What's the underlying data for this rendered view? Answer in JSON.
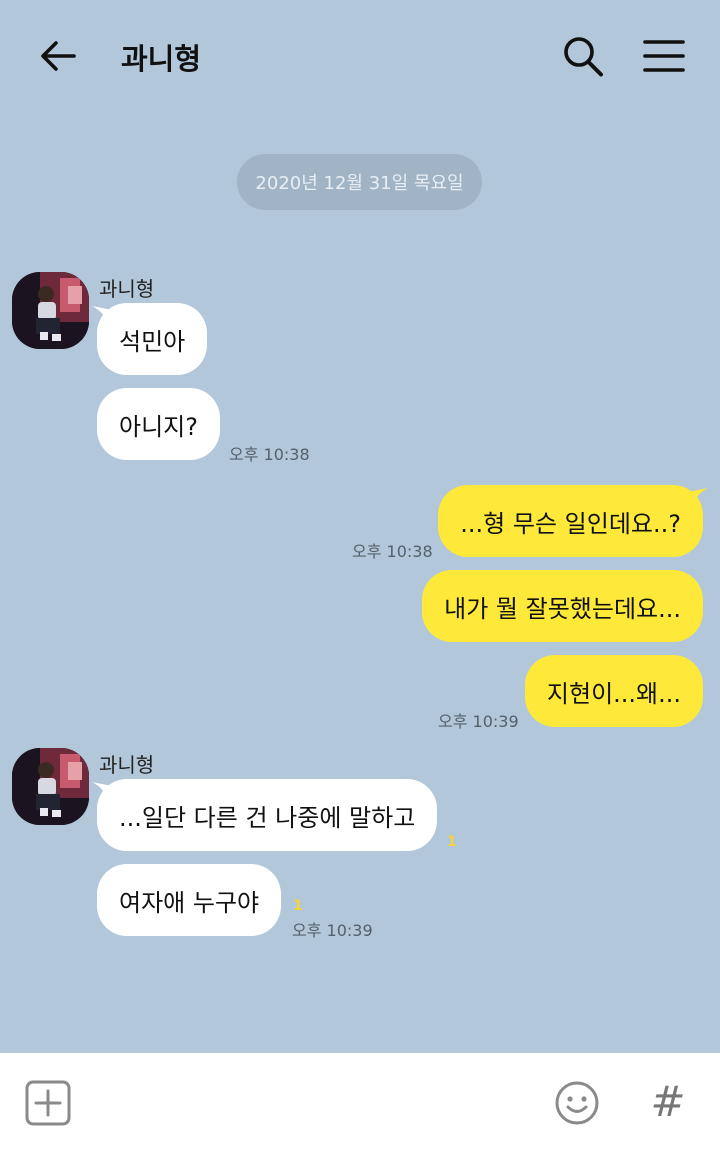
{
  "header": {
    "title": "과니형",
    "back_icon": "back-arrow-icon",
    "search_icon": "search-icon",
    "menu_icon": "hamburger-menu-icon"
  },
  "date_divider": "2020년 12월 31일 목요일",
  "groups": [
    {
      "sender": "과니형",
      "messages": [
        {
          "text": "석민아"
        },
        {
          "text": "아니지?",
          "time": "오후 10:38"
        }
      ]
    },
    {
      "sender": "me",
      "messages": [
        {
          "text": "...형 무슨 일인데요..?",
          "time": "오후 10:38"
        },
        {
          "text": "내가 뭘 잘못했는데요..."
        },
        {
          "text": "지현이...왜...",
          "time": "오후 10:39"
        }
      ]
    },
    {
      "sender": "과니형",
      "messages": [
        {
          "text": "...일단 다른 건 나중에 말하고",
          "unread": "1"
        },
        {
          "text": "여자애 누구야",
          "unread": "1",
          "time": "오후 10:39"
        }
      ]
    }
  ],
  "input_bar": {
    "plus_icon": "add-attachment-icon",
    "emoji_icon": "emoji-icon",
    "hash_label": "#"
  },
  "colors": {
    "background": "#b2c7da",
    "outgoing_bubble": "#fee93b",
    "incoming_bubble": "#ffffff",
    "unread_badge": "#f6d33a"
  }
}
